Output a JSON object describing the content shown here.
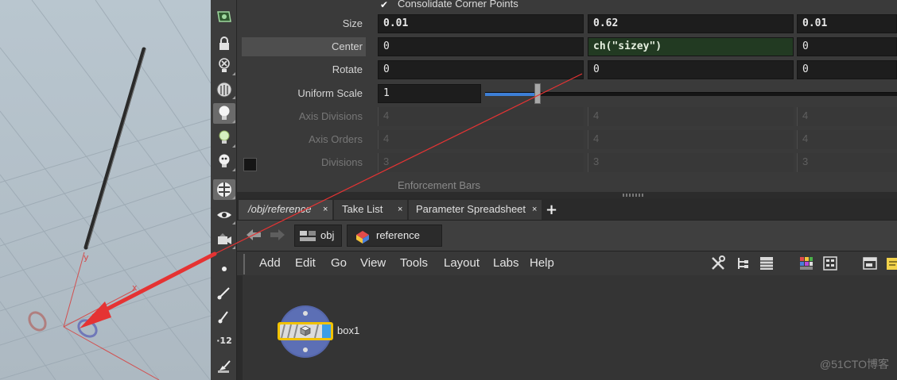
{
  "viewport": {
    "axis_x_label": "x",
    "axis_y_label": "y"
  },
  "params": {
    "consolidate_label": "Consolidate Corner Points",
    "size": {
      "label": "Size",
      "x": "0.01",
      "y": "0.62",
      "z": "0.01"
    },
    "center": {
      "label": "Center",
      "x": "0",
      "y": "ch(\"sizey\")",
      "z": "0"
    },
    "rotate": {
      "label": "Rotate",
      "x": "0",
      "y": "0",
      "z": "0"
    },
    "uniform_scale": {
      "label": "Uniform Scale",
      "value": "1",
      "slider_level": 0.12
    },
    "axis_divisions": {
      "label": "Axis Divisions",
      "x": "4",
      "y": "4",
      "z": "4"
    },
    "axis_orders": {
      "label": "Axis Orders",
      "x": "4",
      "y": "4",
      "z": "4"
    },
    "divisions": {
      "label": "Divisions",
      "x": "3",
      "y": "3",
      "z": "3"
    },
    "enforcement_label": "Enforcement Bars"
  },
  "tabs": [
    {
      "label": "/obj/reference",
      "close": "×",
      "active": true
    },
    {
      "label": "Take List",
      "close": "×",
      "active": false
    },
    {
      "label": "Parameter Spreadsheet",
      "close": "×",
      "active": false
    }
  ],
  "tab_add": "+",
  "pathbar": {
    "back_icon": "back-arrow-icon",
    "forward_icon": "forward-arrow-icon",
    "crumbs": [
      {
        "label": "obj",
        "icon": "obj-context-icon"
      },
      {
        "label": "reference",
        "icon": "geo-object-icon"
      }
    ]
  },
  "menu": [
    "Add",
    "Edit",
    "Go",
    "View",
    "Tools",
    "Layout",
    "Labs",
    "Help"
  ],
  "network": {
    "node_name": "box1"
  },
  "watermark": "@51CTO博客",
  "colors": {
    "accent_blue": "#3d7fd6",
    "node_selected": "#f2c200",
    "expression_bg": "#223a22",
    "annotation_red": "#e53333"
  }
}
